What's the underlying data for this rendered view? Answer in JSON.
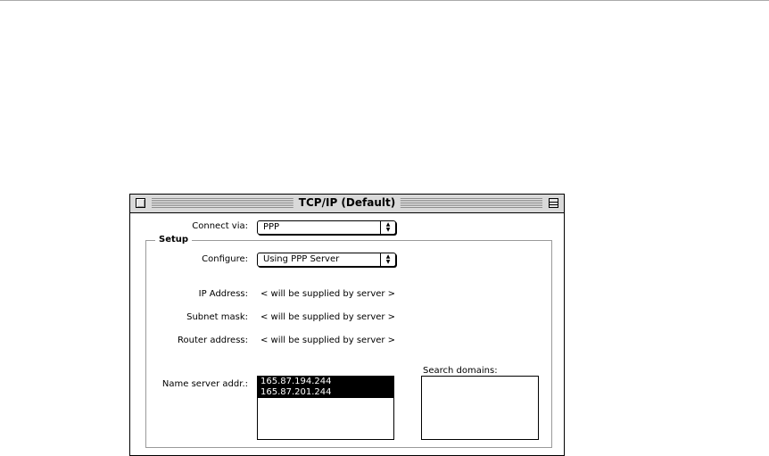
{
  "window": {
    "title": "TCP/IP (Default)"
  },
  "connect": {
    "label": "Connect via:",
    "value": "PPP"
  },
  "setup": {
    "title": "Setup",
    "configure_label": "Configure:",
    "configure_value": "Using PPP Server",
    "ip_label": "IP Address:",
    "ip_value": "< will be supplied by server >",
    "subnet_label": "Subnet mask:",
    "subnet_value": "< will be supplied by server >",
    "router_label": "Router address:",
    "router_value": "< will be supplied by server >",
    "nameserver_label": "Name server addr.:",
    "nameservers": [
      "165.87.194.244",
      "165.87.201.244"
    ],
    "search_label": "Search domains:"
  },
  "icons": {
    "close": "close-box-icon",
    "zoom": "zoom-box-icon",
    "popup_arrow": "up-down-arrows-icon"
  }
}
